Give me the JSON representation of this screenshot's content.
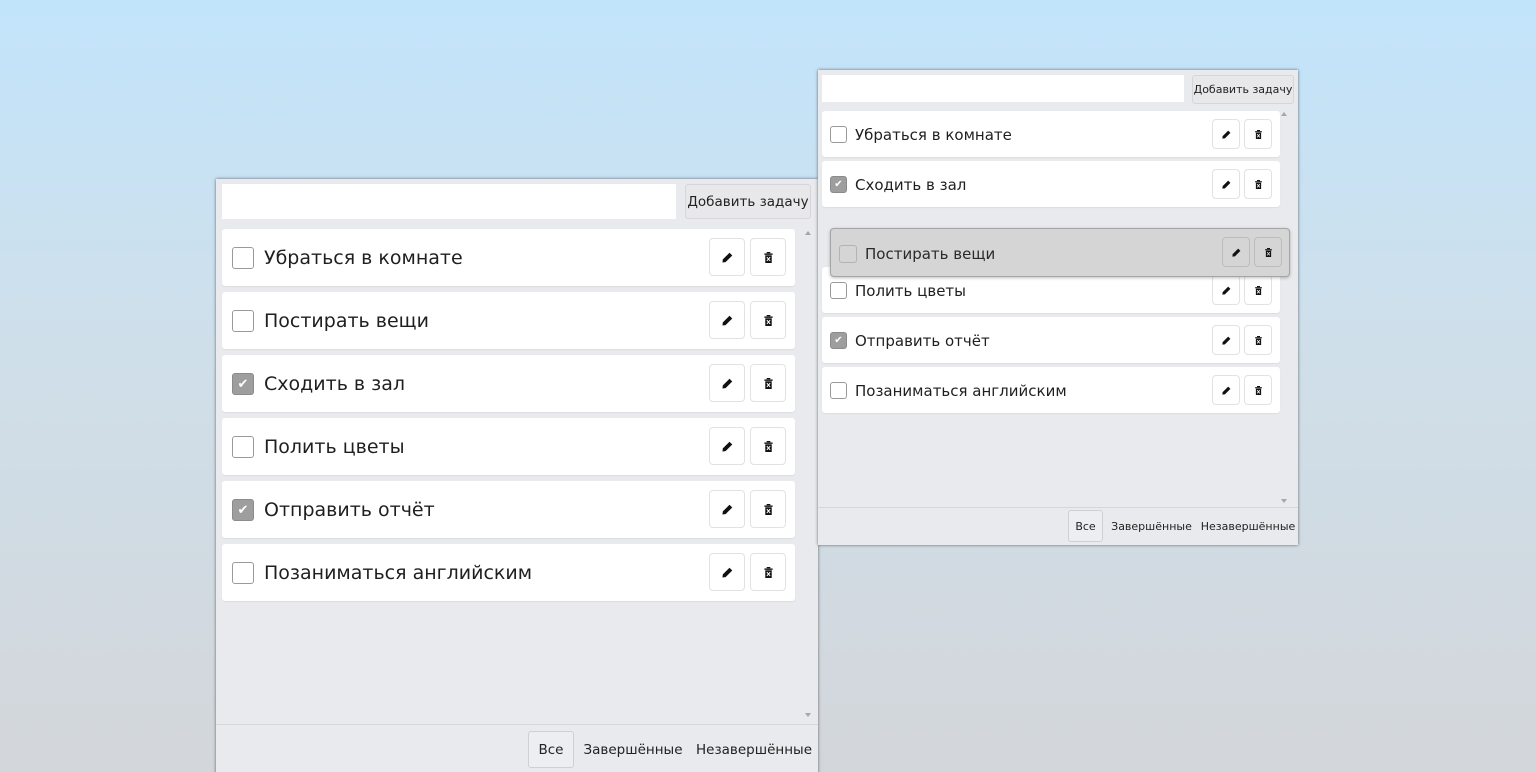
{
  "left_window": {
    "input": {
      "value": "",
      "placeholder": ""
    },
    "add_button": "Добавить задачу",
    "tasks": [
      {
        "text": "Убраться в комнате",
        "done": false
      },
      {
        "text": "Постирать вещи",
        "done": false
      },
      {
        "text": "Сходить в зал",
        "done": true
      },
      {
        "text": "Полить цветы",
        "done": false
      },
      {
        "text": "Отправить отчёт",
        "done": true
      },
      {
        "text": "Позаниматься английским",
        "done": false
      }
    ],
    "filters": {
      "all": "Все",
      "done": "Завершённые",
      "open": "Незавершённые",
      "active": "all"
    }
  },
  "right_window": {
    "input": {
      "value": "",
      "placeholder": ""
    },
    "add_button": "Добавить задачу",
    "tasks": [
      {
        "text": "Убраться в комнате",
        "done": false
      },
      {
        "text": "Сходить в зал",
        "done": true
      },
      {
        "text": "Полить цветы",
        "done": false
      },
      {
        "text": "Отправить отчёт",
        "done": true
      },
      {
        "text": "Позаниматься английским",
        "done": false
      }
    ],
    "dragging_task": {
      "text": "Постирать вещи",
      "done": false
    },
    "filters": {
      "all": "Все",
      "done": "Завершённые",
      "open": "Незавершённые",
      "active": "all"
    }
  },
  "icons": {
    "edit": "pencil-icon",
    "delete": "trash-icon",
    "check": "checkmark-icon"
  },
  "colors": {
    "background_top": "#c2e4fb",
    "background_bottom": "#d3d6da",
    "window": "#e9eaed",
    "checked_box": "#9e9e9e",
    "drag_row": "#d5d5d5"
  }
}
